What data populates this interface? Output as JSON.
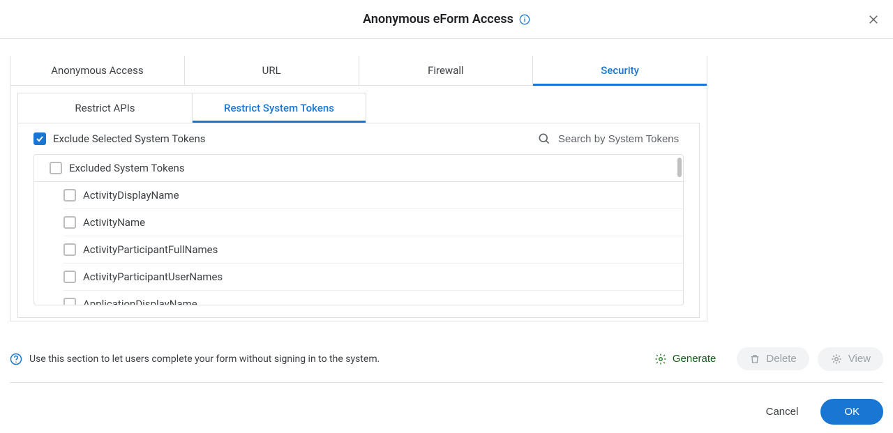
{
  "dialog": {
    "title": "Anonymous eForm Access"
  },
  "mainTabs": [
    {
      "label": "Anonymous Access",
      "active": false
    },
    {
      "label": "URL",
      "active": false
    },
    {
      "label": "Firewall",
      "active": false
    },
    {
      "label": "Security",
      "active": true
    }
  ],
  "subTabs": [
    {
      "label": "Restrict APIs",
      "active": false
    },
    {
      "label": "Restrict System Tokens",
      "active": true
    }
  ],
  "exclude": {
    "label": "Exclude Selected System Tokens",
    "checked": true
  },
  "search": {
    "placeholder": "Search by System Tokens"
  },
  "tokenHeader": {
    "label": "Excluded System Tokens",
    "checked": false
  },
  "tokens": [
    {
      "label": "ActivityDisplayName",
      "checked": false
    },
    {
      "label": "ActivityName",
      "checked": false
    },
    {
      "label": "ActivityParticipantFullNames",
      "checked": false
    },
    {
      "label": "ActivityParticipantUserNames",
      "checked": false
    },
    {
      "label": "ApplicationDisplayName",
      "checked": false
    }
  ],
  "footer": {
    "help": "Use this section to let users complete your form without signing in to the system.",
    "generate": "Generate",
    "delete": "Delete",
    "view": "View"
  },
  "buttons": {
    "cancel": "Cancel",
    "ok": "OK"
  }
}
